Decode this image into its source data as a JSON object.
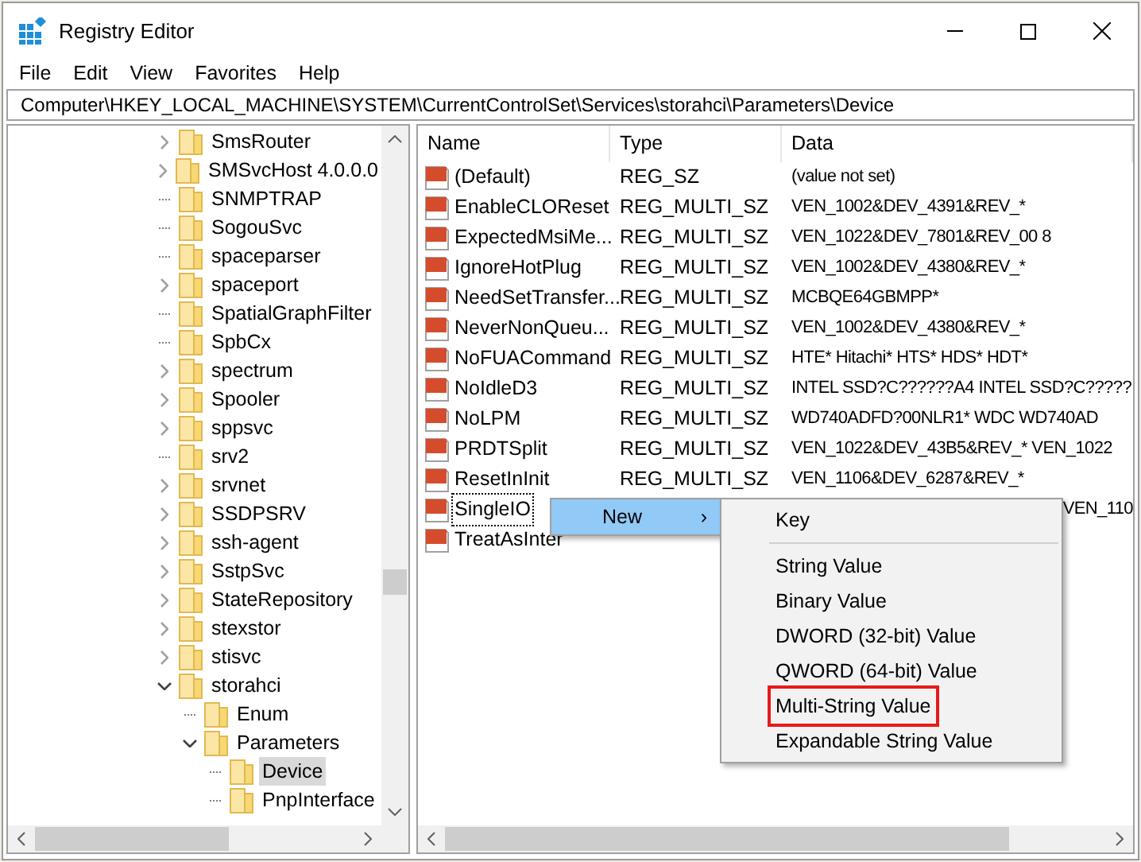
{
  "window": {
    "title": "Registry Editor"
  },
  "menu": [
    "File",
    "Edit",
    "View",
    "Favorites",
    "Help"
  ],
  "address": "Computer\\HKEY_LOCAL_MACHINE\\SYSTEM\\CurrentControlSet\\Services\\storahci\\Parameters\\Device",
  "tree": [
    {
      "label": "SmsRouter",
      "expanded": false,
      "selected": false
    },
    {
      "label": "SMSvcHost 4.0.0.0",
      "expanded": false,
      "selected": false
    },
    {
      "label": "SNMPTRAP",
      "selected": false
    },
    {
      "label": "SogouSvc",
      "selected": false
    },
    {
      "label": "spaceparser",
      "selected": false
    },
    {
      "label": "spaceport",
      "expanded": false,
      "selected": false
    },
    {
      "label": "SpatialGraphFilter",
      "selected": false
    },
    {
      "label": "SpbCx",
      "selected": false
    },
    {
      "label": "spectrum",
      "expanded": false,
      "selected": false
    },
    {
      "label": "Spooler",
      "expanded": false,
      "selected": false
    },
    {
      "label": "sppsvc",
      "expanded": false,
      "selected": false
    },
    {
      "label": "srv2",
      "selected": false
    },
    {
      "label": "srvnet",
      "expanded": false,
      "selected": false
    },
    {
      "label": "SSDPSRV",
      "expanded": false,
      "selected": false
    },
    {
      "label": "ssh-agent",
      "expanded": false,
      "selected": false
    },
    {
      "label": "SstpSvc",
      "expanded": false,
      "selected": false
    },
    {
      "label": "StateRepository",
      "expanded": false,
      "selected": false
    },
    {
      "label": "stexstor",
      "expanded": false,
      "selected": false
    },
    {
      "label": "stisvc",
      "expanded": false,
      "selected": false
    },
    {
      "label": "storahci",
      "expanded": true,
      "selected": false,
      "children": [
        {
          "label": "Enum",
          "selected": false
        },
        {
          "label": "Parameters",
          "expanded": true,
          "selected": false,
          "children": [
            {
              "label": "Device",
              "selected": true
            },
            {
              "label": "PnpInterface",
              "selected": false
            }
          ]
        }
      ]
    }
  ],
  "table": {
    "columns": [
      "Name",
      "Type",
      "Data"
    ],
    "rows": [
      {
        "name": "(Default)",
        "type": "REG_SZ",
        "data": "(value not set)"
      },
      {
        "name": "EnableCLOReset",
        "type": "REG_MULTI_SZ",
        "data": "VEN_1002&DEV_4391&REV_*"
      },
      {
        "name": "ExpectedMsiMe...",
        "type": "REG_MULTI_SZ",
        "data": "VEN_1022&DEV_7801&REV_00 8"
      },
      {
        "name": "IgnoreHotPlug",
        "type": "REG_MULTI_SZ",
        "data": "VEN_1002&DEV_4380&REV_*"
      },
      {
        "name": "NeedSetTransfer...",
        "type": "REG_MULTI_SZ",
        "data": "MCBQE64GBMPP*"
      },
      {
        "name": "NeverNonQueu...",
        "type": "REG_MULTI_SZ",
        "data": "VEN_1002&DEV_4380&REV_*"
      },
      {
        "name": "NoFUACommand",
        "type": "REG_MULTI_SZ",
        "data": "HTE* Hitachi* HTS* HDS* HDT*"
      },
      {
        "name": "NoIdleD3",
        "type": "REG_MULTI_SZ",
        "data": "INTEL SSD?C??????A4 INTEL SSD?C?????"
      },
      {
        "name": "NoLPM",
        "type": "REG_MULTI_SZ",
        "data": "WD740ADFD?00NLR1* WDC WD740AD"
      },
      {
        "name": "PRDTSplit",
        "type": "REG_MULTI_SZ",
        "data": "VEN_1022&DEV_43B5&REV_* VEN_1022"
      },
      {
        "name": "ResetInInit",
        "type": "REG_MULTI_SZ",
        "data": "VEN_1106&DEV_6287&REV_*"
      },
      {
        "name": "SingleIO",
        "data": "VEN_110",
        "focused": true
      },
      {
        "name": "TreatAsInter"
      }
    ]
  },
  "context_menu": {
    "items": [
      {
        "label": "New",
        "arrow": "›",
        "selected": true
      }
    ],
    "submenu": [
      {
        "label": "Key",
        "highlighted": false
      },
      {
        "kind": "separator"
      },
      {
        "label": "String Value",
        "highlighted": false
      },
      {
        "label": "Binary Value",
        "highlighted": false
      },
      {
        "label": "DWORD (32-bit) Value",
        "highlighted": false
      },
      {
        "label": "QWORD (64-bit) Value",
        "highlighted": false
      },
      {
        "label": "Multi-String Value",
        "highlighted": true
      },
      {
        "label": "Expandable String Value",
        "highlighted": false
      }
    ]
  }
}
